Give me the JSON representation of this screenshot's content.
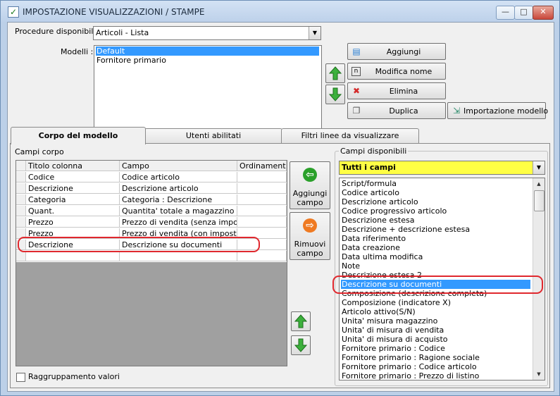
{
  "window": {
    "title": "IMPOSTAZIONE VISUALIZZAZIONI / STAMPE"
  },
  "procedure": {
    "label": "Procedure disponibili :",
    "value": "Articoli - Lista"
  },
  "modelli": {
    "label": "Modelli :",
    "items": [
      "Default",
      "Fornitore primario"
    ],
    "selected_index": 0
  },
  "buttons": {
    "aggiungi": "Aggiungi",
    "modifica_nome": "Modifica nome",
    "elimina": "Elimina",
    "duplica": "Duplica",
    "importazione_modello": "Importazione modello"
  },
  "tabs": [
    "Corpo del modello",
    "Utenti abilitati",
    "Filtri linee da visualizzare"
  ],
  "active_tab": 0,
  "campi_corpo": {
    "label": "Campi corpo",
    "columns": [
      "Titolo colonna",
      "Campo",
      "Ordinamento"
    ],
    "rows": [
      [
        "Codice",
        "Codice articolo",
        ""
      ],
      [
        "Descrizione",
        "Descrizione articolo",
        ""
      ],
      [
        "Categoria",
        "Categoria : Descrizione",
        ""
      ],
      [
        "Quant.",
        "Quantita' totale a magazzino",
        ""
      ],
      [
        "Prezzo",
        "Prezzo di vendita (senza imposte)",
        ""
      ],
      [
        "Prezzo",
        "Prezzo di vendita (con imposte)",
        ""
      ],
      [
        "Descrizione",
        "Descrizione su documenti",
        ""
      ],
      [
        "",
        "",
        ""
      ]
    ]
  },
  "aggiungi_campo": {
    "line1": "Aggiungi",
    "line2": "campo"
  },
  "rimuovi_campo": {
    "line1": "Rimuovi",
    "line2": "campo"
  },
  "raggruppamento": {
    "label": "Raggruppamento valori",
    "checked": false
  },
  "campi_disponibili": {
    "label": "Campi disponibili",
    "filter_value": "Tutti i campi",
    "filter_highlight_color": "#ffff44",
    "items": [
      "Script/formula",
      "Codice articolo",
      "Descrizione articolo",
      "Codice progressivo articolo",
      "Descrizione estesa",
      "Descrizione + descrizione estesa",
      "Data riferimento",
      "Data creazione",
      "Data ultima modifica",
      "Note",
      "Descrizione estesa 2",
      "Descrizione su documenti",
      "Composizione (descrizione completa)",
      "Composizione (indicatore X)",
      "Articolo attivo(S/N)",
      "Unita' misura magazzino",
      "Unita' di misura di vendita",
      "Unita' di misura di acquisto",
      "Fornitore primario : Codice",
      "Fornitore primario : Ragione sociale",
      "Fornitore primario : Codice articolo",
      "Fornitore primario : Prezzo di listino"
    ],
    "selected_index": 11
  },
  "colors": {
    "selection": "#3399ff",
    "annotation": "#e0282e",
    "titlebar": "#bdd1ea"
  }
}
